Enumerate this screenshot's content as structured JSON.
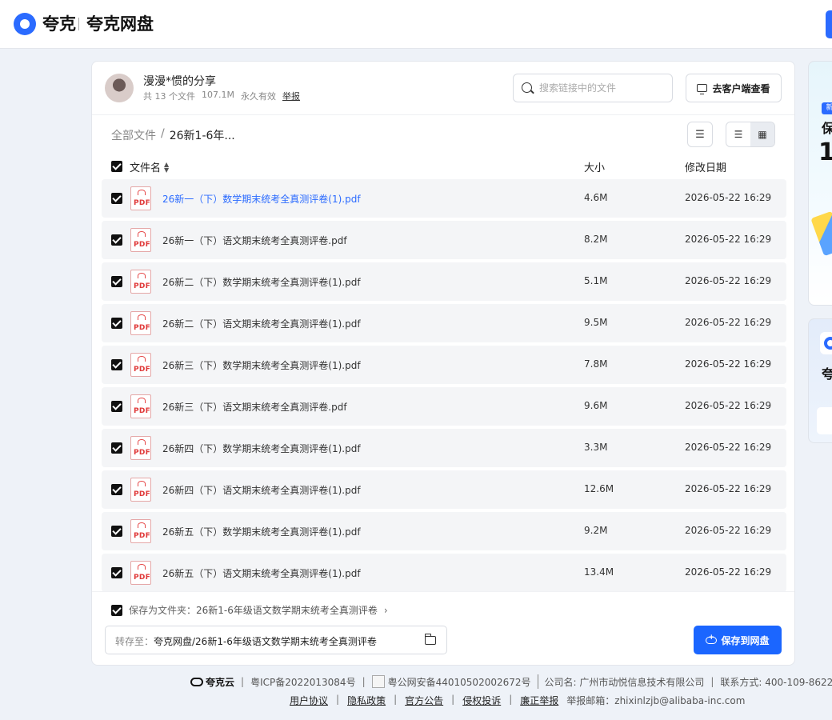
{
  "header": {
    "brand": "夸克",
    "product": "夸克网盘"
  },
  "share": {
    "title": "漫漫*惯的分享",
    "file_count": "共 13 个文件",
    "total_size": "107.1M",
    "validity": "永久有效",
    "report": "举报"
  },
  "search": {
    "placeholder": "搜索链接中的文件"
  },
  "client_button": "去客户端查看",
  "breadcrumb": {
    "root": "全部文件",
    "separator": "/",
    "current": "26新1-6年..."
  },
  "table": {
    "col_name": "文件名",
    "col_size": "大小",
    "col_date": "修改日期",
    "rows": [
      {
        "name": "26新一（下）数学期末统考全真测评卷(1).pdf",
        "size": "4.6M",
        "date": "2026-05-22 16:29"
      },
      {
        "name": "26新一（下）语文期末统考全真测评卷.pdf",
        "size": "8.2M",
        "date": "2026-05-22 16:29"
      },
      {
        "name": "26新二（下）数学期末统考全真测评卷(1).pdf",
        "size": "5.1M",
        "date": "2026-05-22 16:29"
      },
      {
        "name": "26新二（下）语文期末统考全真测评卷(1).pdf",
        "size": "9.5M",
        "date": "2026-05-22 16:29"
      },
      {
        "name": "26新三（下）数学期末统考全真测评卷(1).pdf",
        "size": "7.8M",
        "date": "2026-05-22 16:29"
      },
      {
        "name": "26新三（下）语文期末统考全真测评卷.pdf",
        "size": "9.6M",
        "date": "2026-05-22 16:29"
      },
      {
        "name": "26新四（下）数学期末统考全真测评卷(1).pdf",
        "size": "3.3M",
        "date": "2026-05-22 16:29"
      },
      {
        "name": "26新四（下）语文期末统考全真测评卷(1).pdf",
        "size": "12.6M",
        "date": "2026-05-22 16:29"
      },
      {
        "name": "26新五（下）数学期末统考全真测评卷(1).pdf",
        "size": "9.2M",
        "date": "2026-05-22 16:29"
      },
      {
        "name": "26新五（下）语文期末统考全真测评卷(1).pdf",
        "size": "13.4M",
        "date": "2026-05-22 16:29"
      }
    ]
  },
  "save_folder": {
    "label": "保存为文件夹：",
    "value": "26新1-6年级语文数学期末统考全真测评卷",
    "chevron": "›"
  },
  "transfer": {
    "label": "转存至：",
    "path": "夸克网盘/26新1-6年级语文数学期末统考全真测评卷"
  },
  "save_button": "保存到网盘",
  "side_ads": {
    "ad1_badge": "新",
    "ad1_title": "保",
    "ad1_big": "1",
    "ad2_title": "夸"
  },
  "footer": {
    "brand": "夸克云",
    "icp": "粤ICP备2022013084号",
    "police": "粤公网安备44010502002672号",
    "company": "公司名: 广州市动悦信息技术有限公司",
    "phone": "联系方式: 400-109-8622",
    "links": [
      "用户协议",
      "隐私政策",
      "官方公告",
      "侵权投诉",
      "廉正举报"
    ],
    "report_email": "举报邮箱：zhixinlzjb@alibaba-inc.com"
  }
}
